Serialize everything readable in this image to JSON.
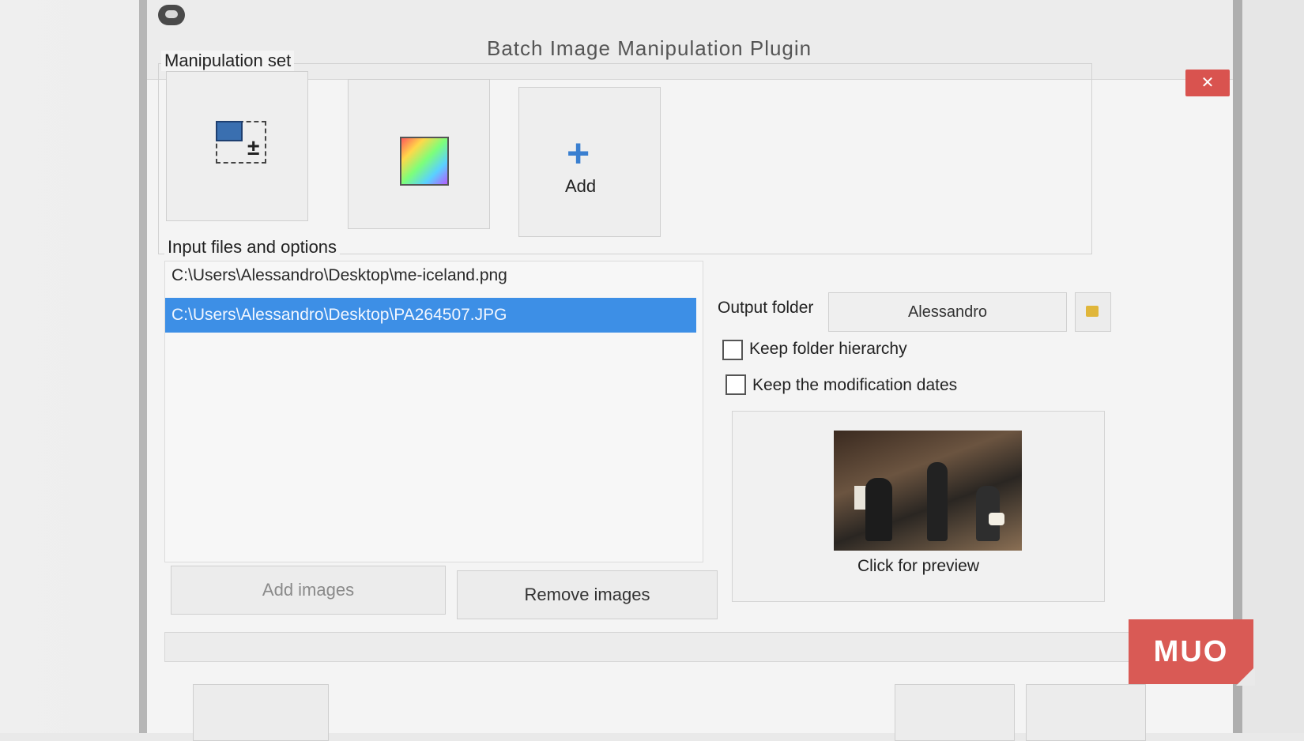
{
  "window": {
    "title": "Batch Image Manipulation Plugin",
    "close_label": "✕"
  },
  "manipulation": {
    "group_label": "Manipulation set",
    "add_label": "Add"
  },
  "input": {
    "group_label": "Input files and options",
    "files": [
      "C:\\Users\\Alessandro\\Desktop\\me-iceland.png",
      "C:\\Users\\Alessandro\\Desktop\\PA264507.JPG"
    ],
    "add_images_label": "Add images",
    "remove_images_label": "Remove images"
  },
  "output": {
    "folder_label": "Output folder",
    "folder_value": "Alessandro",
    "keep_hierarchy_label": "Keep folder hierarchy",
    "keep_hierarchy_checked": false,
    "keep_dates_label": "Keep the modification dates",
    "keep_dates_checked": false
  },
  "preview": {
    "label": "Click for preview"
  },
  "watermark": {
    "text": "MUO"
  },
  "colors": {
    "selection": "#3d8fe6",
    "close": "#d9534f",
    "add_icon": "#3a7fd0",
    "watermark": "#d95a55"
  }
}
